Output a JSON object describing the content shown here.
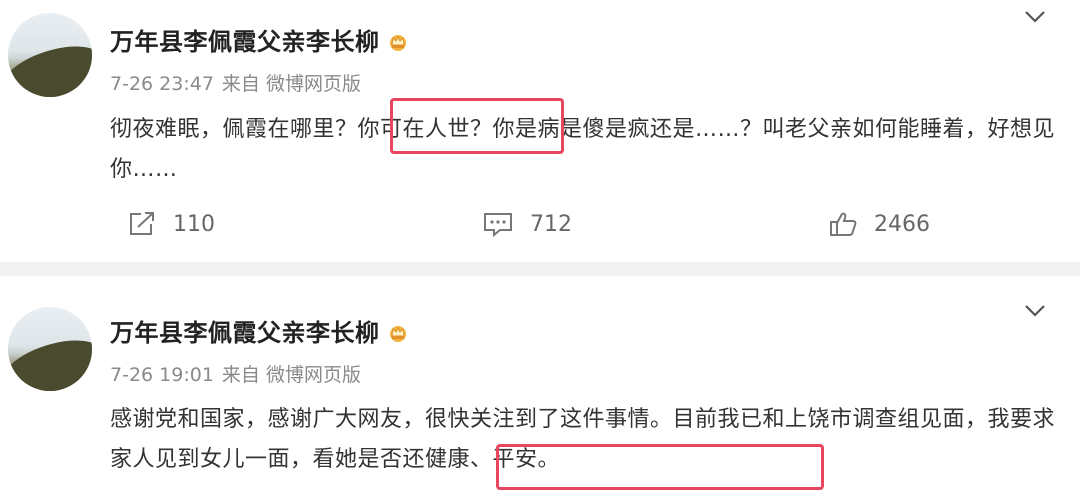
{
  "posts": [
    {
      "author": "万年县李佩霞父亲李长柳",
      "time": "7-26 23:47",
      "source_prefix": "来自",
      "source": "微博网页版",
      "content": "彻夜难眠，佩霞在哪里？你可在人世？你是病是傻是疯还是……？叫老父亲如何能睡着，好想见你……",
      "highlight": "你可在人世？",
      "actions": {
        "share": "110",
        "comment": "712",
        "like": "2466"
      }
    },
    {
      "author": "万年县李佩霞父亲李长柳",
      "time": "7-26 19:01",
      "source_prefix": "来自",
      "source": "微博网页版",
      "content": "感谢党和国家，感谢广大网友，很快关注到了这件事情。目前我已和上饶市调查组见面，我要求家人见到女儿一面，看她是否还健康、平安。",
      "highlight": "看她是否还健康、平安。"
    }
  ],
  "icons": {
    "crown": "crown-icon",
    "chevron": "chevron-down-icon",
    "share": "share-icon",
    "comment": "comment-icon",
    "like": "thumbs-up-icon"
  },
  "colors": {
    "highlight_border": "#e8455f",
    "crown": "#f0b23a",
    "divider": "#f2f2f2"
  }
}
